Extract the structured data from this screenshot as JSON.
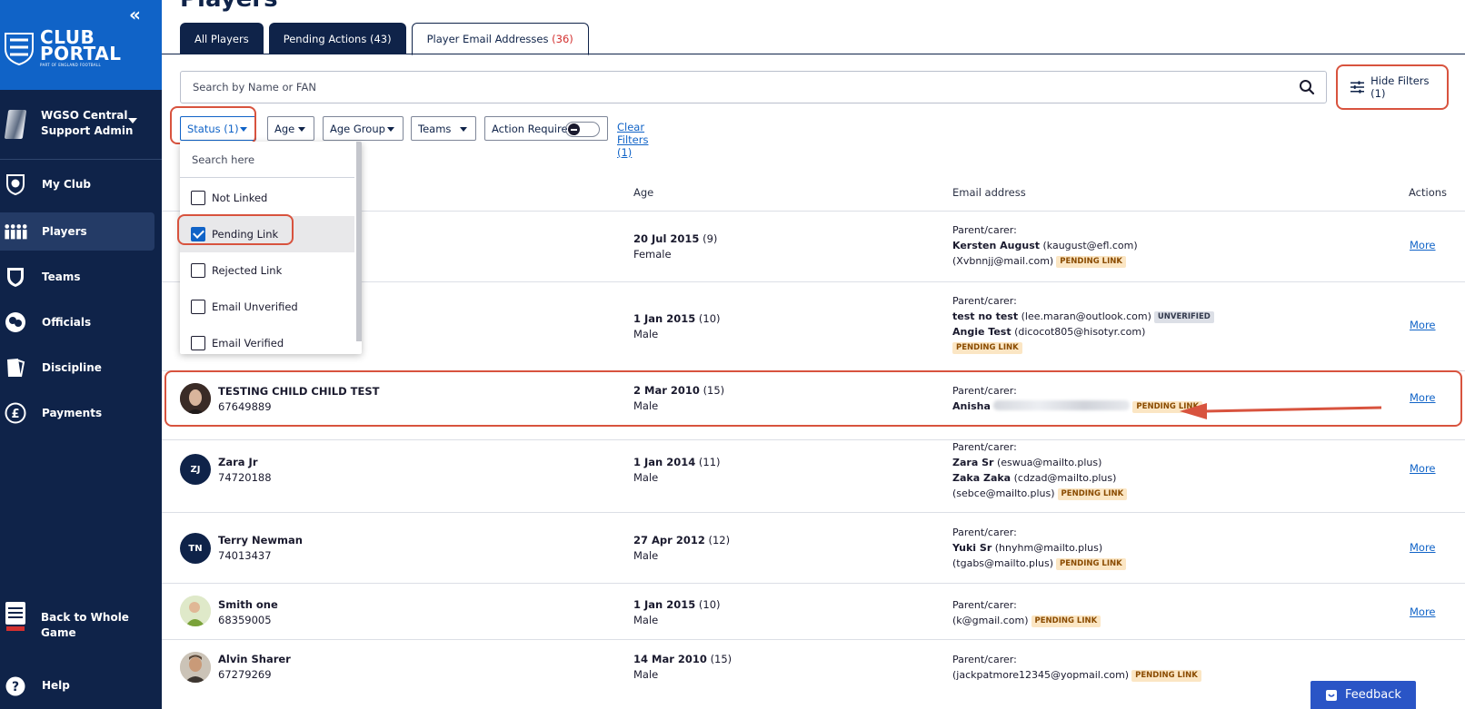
{
  "sidebar": {
    "logo": {
      "line1": "CLUB",
      "line2": "PORTAL",
      "tagline": "PART OF ENGLAND FOOTBALL"
    },
    "user": {
      "line1": "WGSO Central",
      "line2": "Support Admin"
    },
    "nav": [
      {
        "label": "My Club",
        "icon": "shield-icon",
        "active": false
      },
      {
        "label": "Players",
        "icon": "players-icon",
        "active": true
      },
      {
        "label": "Teams",
        "icon": "kit-icon",
        "active": false
      },
      {
        "label": "Officials",
        "icon": "whistle-icon",
        "active": false
      },
      {
        "label": "Discipline",
        "icon": "cards-icon",
        "active": false
      },
      {
        "label": "Payments",
        "icon": "pound-icon",
        "active": false
      }
    ],
    "back": {
      "line1": "Back to Whole",
      "line2": "Game"
    },
    "help": "Help"
  },
  "page": {
    "title": "Players"
  },
  "tabs": [
    {
      "label": "All Players",
      "count": ""
    },
    {
      "label": "Pending Actions",
      "count": "(43)"
    },
    {
      "label": "Player Email Addresses",
      "count": "(36)"
    }
  ],
  "search": {
    "placeholder": "Search by Name or FAN",
    "value": ""
  },
  "hide_filters": "Hide Filters (1)",
  "filters": {
    "status": "Status (1)",
    "age": "Age",
    "age_group": "Age Group",
    "teams": "Teams",
    "action_required": "Action Required",
    "clear": "Clear Filters (1)"
  },
  "status_dropdown": {
    "search_placeholder": "Search here",
    "options": [
      {
        "label": "Not Linked",
        "checked": false
      },
      {
        "label": "Pending Link",
        "checked": true
      },
      {
        "label": "Rejected Link",
        "checked": false
      },
      {
        "label": "Email Unverified",
        "checked": false
      },
      {
        "label": "Email Verified",
        "checked": false
      }
    ]
  },
  "table": {
    "headers": {
      "age": "Age",
      "email": "Email address",
      "actions": "Actions"
    },
    "rows": [
      {
        "name": "",
        "fan": "",
        "avatar": "",
        "dob": "20 Jul 2015",
        "age": "(9)",
        "gender": "Female",
        "parent_label": "Parent/carer:",
        "email_line1_name": "Kersten August",
        "email_line1_addr": "(kaugust@efl.com)",
        "email_line2": "(Xvbnnjj@mail.com)",
        "badge": "PENDING LINK",
        "more": "More"
      },
      {
        "name": "",
        "fan": "",
        "avatar": "",
        "dob": "1 Jan 2015",
        "age": "(10)",
        "gender": "Male",
        "parent_label": "Parent/carer:",
        "email_line1_name": "test no test",
        "email_line1_addr": "(lee.maran@outlook.com)",
        "badge1": "UNVERIFIED",
        "email_line2_name": "Angie Test",
        "email_line2_addr": "(dicocot805@hisotyr.com)",
        "badge": "PENDING LINK",
        "more": "More"
      },
      {
        "name": "TESTING CHILD CHILD TEST",
        "fan": "67649889",
        "avatar": "",
        "dob": "2 Mar 2010",
        "age": "(15)",
        "gender": "Male",
        "parent_label": "Parent/carer:",
        "email_line1_name": "Anisha",
        "badge": "PENDING LINK",
        "more": "More"
      },
      {
        "name": "Zara Jr",
        "fan": "74720188",
        "avatar": "ZJ",
        "dob": "1 Jan 2014",
        "age": "(11)",
        "gender": "Male",
        "parent_label": "Parent/carer:",
        "email_line1_name": "Zara Sr",
        "email_line1_addr": "(eswua@mailto.plus)",
        "email_line2_name": "Zaka Zaka",
        "email_line2_addr": "(cdzad@mailto.plus)",
        "email_line3": "(sebce@mailto.plus)",
        "badge": "PENDING LINK",
        "more": "More"
      },
      {
        "name": "Terry Newman",
        "fan": "74013437",
        "avatar": "TN",
        "dob": "27 Apr 2012",
        "age": "(12)",
        "gender": "Male",
        "parent_label": "Parent/carer:",
        "email_line1_name": "Yuki Sr",
        "email_line1_addr": "(hnyhm@mailto.plus)",
        "email_line2": "(tgabs@mailto.plus)",
        "badge": "PENDING LINK",
        "more": "More"
      },
      {
        "name": "Smith one",
        "fan": "68359005",
        "avatar": "",
        "dob": "1 Jan 2015",
        "age": "(10)",
        "gender": "Male",
        "parent_label": "Parent/carer:",
        "email_line1": "(k@gmail.com)",
        "badge": "PENDING LINK",
        "more": "More"
      },
      {
        "name": "Alvin Sharer",
        "fan": "67279269",
        "avatar": "",
        "dob": "14 Mar 2010",
        "age": "(15)",
        "gender": "Male",
        "parent_label": "Parent/carer:",
        "email_line1": "(jackpatmore12345@yopmail.com)",
        "badge": "PENDING LINK",
        "more": "More"
      }
    ]
  },
  "feedback": "Feedback",
  "colors": {
    "sidebar": "#0f2349",
    "brand_blue": "#1063c7",
    "highlight_red": "#d8533e",
    "pending_badge": "#fbe6c4",
    "feedback": "#2a55c6"
  }
}
